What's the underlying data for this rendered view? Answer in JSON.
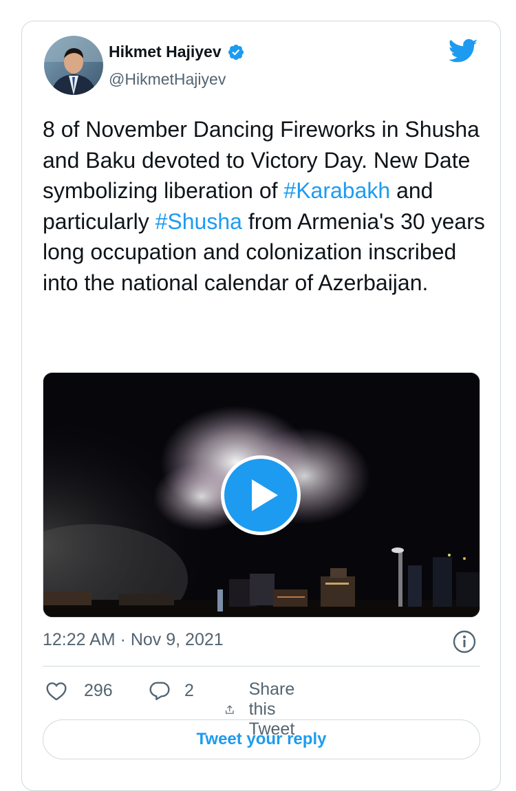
{
  "author": {
    "name": "Hikmet Hajiyev",
    "handle": "@HikmetHajiyev",
    "verified": true
  },
  "tweet": {
    "text_parts": [
      {
        "text": "8 of November Dancing Fireworks in Shusha and Baku devoted to Victory Day. New Date symbolizing liberation of ",
        "tag": false
      },
      {
        "text": "#Karabakh",
        "tag": true
      },
      {
        "text": " and particularly ",
        "tag": false
      },
      {
        "text": "#Shusha",
        "tag": true
      },
      {
        "text": " from Armenia's 30 years long occupation and colonization inscribed into the national calendar of Azerbaijan.",
        "tag": false
      }
    ],
    "timestamp": "12:22 AM · Nov 9, 2021"
  },
  "media": {
    "type": "video",
    "icon": "play-icon"
  },
  "actions": {
    "like_count": "296",
    "reply_count": "2",
    "share_label": "Share this Tweet"
  },
  "reply_button_label": "Tweet your reply",
  "colors": {
    "accent": "#1d9bf0",
    "text": "#0f1419",
    "secondary": "#536471",
    "border": "#cfd9de"
  }
}
